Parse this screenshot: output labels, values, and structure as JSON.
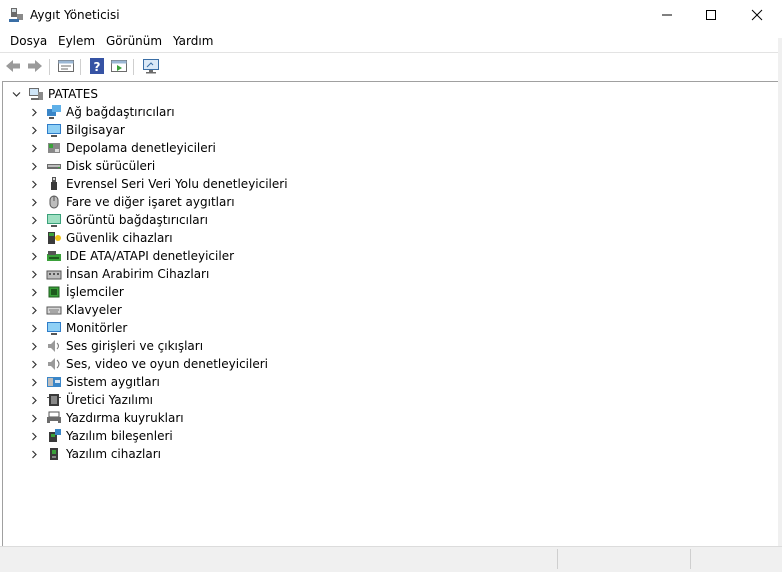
{
  "window": {
    "title": "Aygıt Yöneticisi"
  },
  "menu": [
    "Dosya",
    "Eylem",
    "Görünüm",
    "Yardım"
  ],
  "toolbar": [
    "back-icon",
    "forward-icon",
    "properties-icon",
    "help-icon",
    "driver-view-icon",
    "monitor-scan-icon"
  ],
  "tree": {
    "root": "PATATES",
    "items": [
      {
        "label": "Ağ bağdaştırıcıları",
        "icon": "network-adapter-icon"
      },
      {
        "label": "Bilgisayar",
        "icon": "computer-icon"
      },
      {
        "label": "Depolama denetleyicileri",
        "icon": "storage-controller-icon"
      },
      {
        "label": "Disk sürücüleri",
        "icon": "disk-drive-icon"
      },
      {
        "label": "Evrensel Seri Veri Yolu denetleyicileri",
        "icon": "usb-icon"
      },
      {
        "label": "Fare ve diğer işaret aygıtları",
        "icon": "mouse-icon"
      },
      {
        "label": "Görüntü bağdaştırıcıları",
        "icon": "display-adapter-icon"
      },
      {
        "label": "Güvenlik cihazları",
        "icon": "security-device-icon"
      },
      {
        "label": "IDE ATA/ATAPI denetleyiciler",
        "icon": "ide-controller-icon"
      },
      {
        "label": "İnsan Arabirim Cihazları",
        "icon": "hid-icon"
      },
      {
        "label": "İşlemciler",
        "icon": "processor-icon"
      },
      {
        "label": "Klavyeler",
        "icon": "keyboard-icon"
      },
      {
        "label": "Monitörler",
        "icon": "monitor-icon"
      },
      {
        "label": "Ses girişleri ve çıkışları",
        "icon": "audio-io-icon"
      },
      {
        "label": "Ses, video ve oyun denetleyicileri",
        "icon": "sound-controller-icon"
      },
      {
        "label": "Sistem aygıtları",
        "icon": "system-device-icon"
      },
      {
        "label": "Üretici Yazılımı",
        "icon": "firmware-icon"
      },
      {
        "label": "Yazdırma kuyrukları",
        "icon": "print-queue-icon"
      },
      {
        "label": "Yazılım bileşenleri",
        "icon": "software-component-icon"
      },
      {
        "label": "Yazılım cihazları",
        "icon": "software-device-icon"
      }
    ]
  }
}
